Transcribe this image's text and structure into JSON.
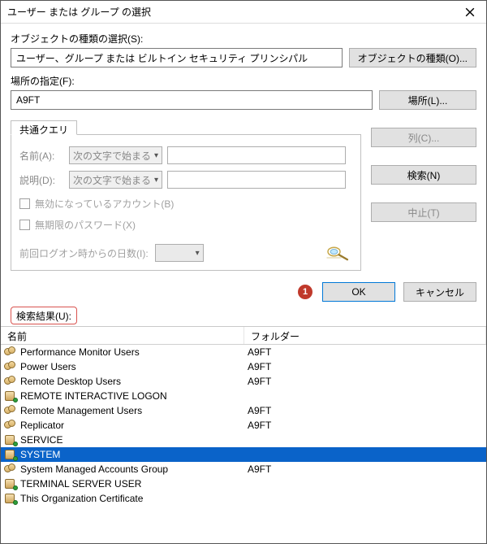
{
  "window": {
    "title": "ユーザー または グループ の選択"
  },
  "upper": {
    "object_type_label": "オブジェクトの種類の選択(S):",
    "object_type_value": "ユーザー、グループ または ビルトイン セキュリティ プリンシパル",
    "object_type_button": "オブジェクトの種類(O)...",
    "location_label": "場所の指定(F):",
    "location_value": "A9FT",
    "location_button": "場所(L)..."
  },
  "query": {
    "tab_label": "共通クエリ",
    "name_label": "名前(A):",
    "name_combo": "次の文字で始まる",
    "desc_label": "説明(D):",
    "desc_combo": "次の文字で始まる",
    "chk_disabled": "無効になっているアカウント(B)",
    "chk_noexpire": "無期限のパスワード(X)",
    "days_label": "前回ログオン時からの日数(I):",
    "btn_columns": "列(C)...",
    "btn_search": "検索(N)",
    "btn_stop": "中止(T)"
  },
  "buttons": {
    "ok": "OK",
    "cancel": "キャンセル"
  },
  "annotation": {
    "num": "1"
  },
  "results": {
    "label": "検索結果(U):",
    "columns": {
      "name": "名前",
      "folder": "フォルダー"
    },
    "rows": [
      {
        "icon": "group",
        "name": "Performance Monitor Users",
        "folder": "A9FT"
      },
      {
        "icon": "group",
        "name": "Power Users",
        "folder": "A9FT"
      },
      {
        "icon": "group",
        "name": "Remote Desktop Users",
        "folder": "A9FT"
      },
      {
        "icon": "principal",
        "name": "REMOTE INTERACTIVE LOGON",
        "folder": ""
      },
      {
        "icon": "group",
        "name": "Remote Management Users",
        "folder": "A9FT"
      },
      {
        "icon": "group",
        "name": "Replicator",
        "folder": "A9FT"
      },
      {
        "icon": "principal",
        "name": "SERVICE",
        "folder": ""
      },
      {
        "icon": "principal",
        "name": "SYSTEM",
        "folder": "",
        "selected": true
      },
      {
        "icon": "group",
        "name": "System Managed Accounts Group",
        "folder": "A9FT"
      },
      {
        "icon": "principal",
        "name": "TERMINAL SERVER USER",
        "folder": ""
      },
      {
        "icon": "principal",
        "name": "This Organization Certificate",
        "folder": ""
      }
    ]
  }
}
